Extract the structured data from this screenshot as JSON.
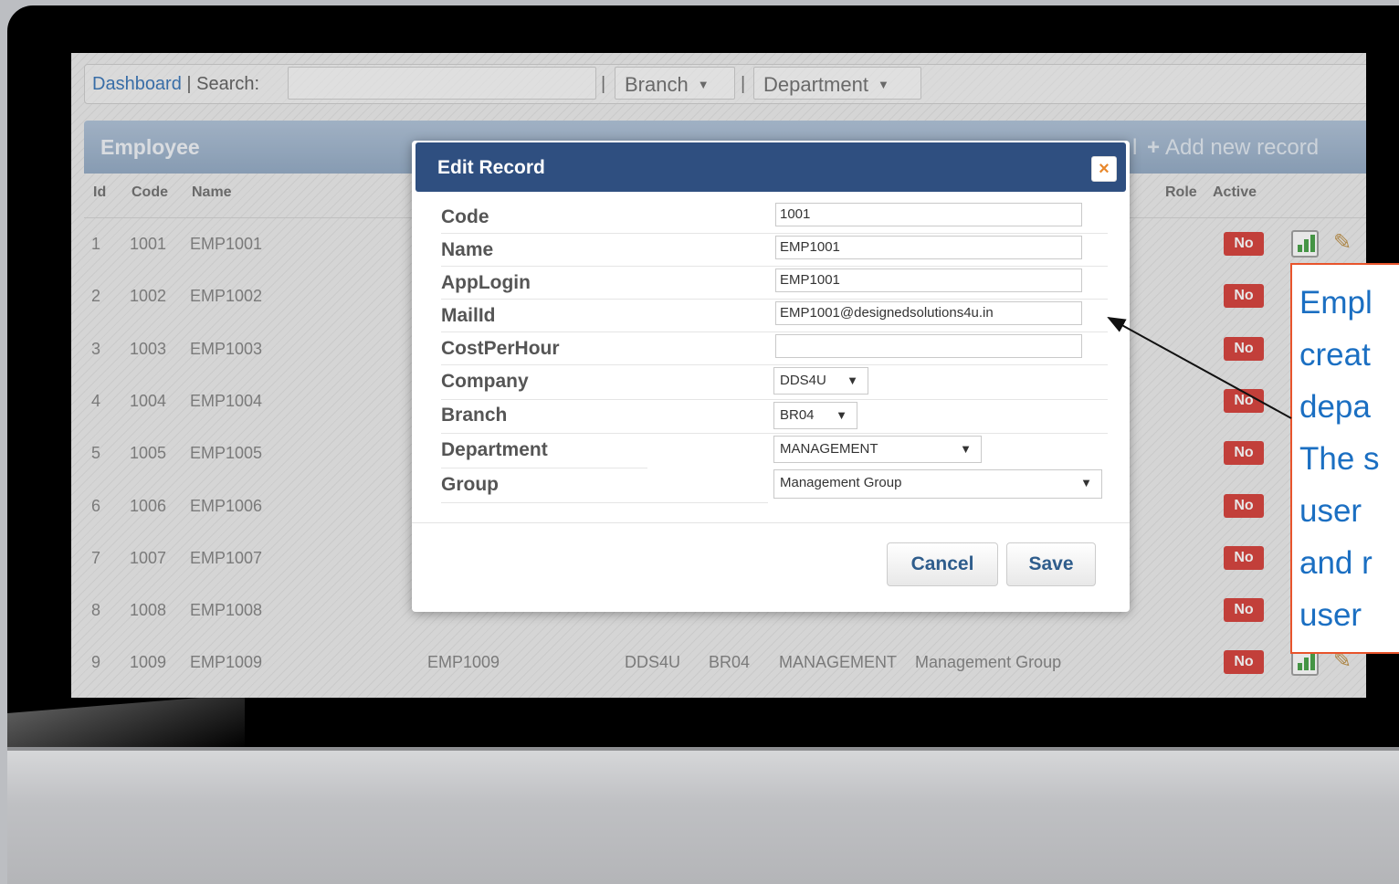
{
  "topbar": {
    "dashboard": "Dashboard",
    "search_label": "| Search:",
    "branch": "Branch",
    "department": "Department"
  },
  "panel": {
    "title": "Employee",
    "excel_fragment": "l",
    "add_new": "Add new record"
  },
  "table": {
    "headers": {
      "id": "Id",
      "code": "Code",
      "name": "Name",
      "role": "Role",
      "active": "Active"
    },
    "rows": [
      {
        "id": "1",
        "code": "1001",
        "name": "EMP1001",
        "active": "No"
      },
      {
        "id": "2",
        "code": "1002",
        "name": "EMP1002",
        "active": "No"
      },
      {
        "id": "3",
        "code": "1003",
        "name": "EMP1003",
        "active": "No"
      },
      {
        "id": "4",
        "code": "1004",
        "name": "EMP1004",
        "active": "No"
      },
      {
        "id": "5",
        "code": "1005",
        "name": "EMP1005",
        "active": "No"
      },
      {
        "id": "6",
        "code": "1006",
        "name": "EMP1006",
        "active": "No"
      },
      {
        "id": "7",
        "code": "1007",
        "name": "EMP1007",
        "active": "No"
      },
      {
        "id": "8",
        "code": "1008",
        "name": "EMP1008",
        "active": "No"
      },
      {
        "id": "9",
        "code": "1009",
        "name": "EMP1009",
        "active": "No",
        "login": "EMP1009",
        "company": "DDS4U",
        "branch": "BR04",
        "department": "MANAGEMENT",
        "group": "Management Group"
      }
    ]
  },
  "modal": {
    "title": "Edit Record",
    "close_glyph": "×",
    "labels": {
      "code": "Code",
      "name": "Name",
      "applogin": "AppLogin",
      "mailid": "MailId",
      "costperhour": "CostPerHour",
      "company": "Company",
      "branch": "Branch",
      "department": "Department",
      "group": "Group"
    },
    "values": {
      "code": "1001",
      "name": "EMP1001",
      "applogin": "EMP1001",
      "mailid": "EMP1001@designedsolutions4u.in",
      "costperhour": "",
      "company": "DDS4U",
      "branch": "BR04",
      "department": "MANAGEMENT",
      "group": "Management Group"
    },
    "cancel": "Cancel",
    "save": "Save"
  },
  "callout": {
    "lines": [
      "Empl",
      "creat",
      "depa",
      "The s",
      "user",
      "and r",
      "user"
    ]
  },
  "colors": {
    "header_blue": "#2f4f80",
    "badge_red": "#d2322d",
    "callout_text": "#1b6fc2",
    "callout_border": "#e8542c"
  },
  "icons": {
    "close": "close-icon",
    "plus": "plus-icon",
    "chart": "chart-icon",
    "pencil": "pencil-icon",
    "caret": "caret-down-icon"
  }
}
